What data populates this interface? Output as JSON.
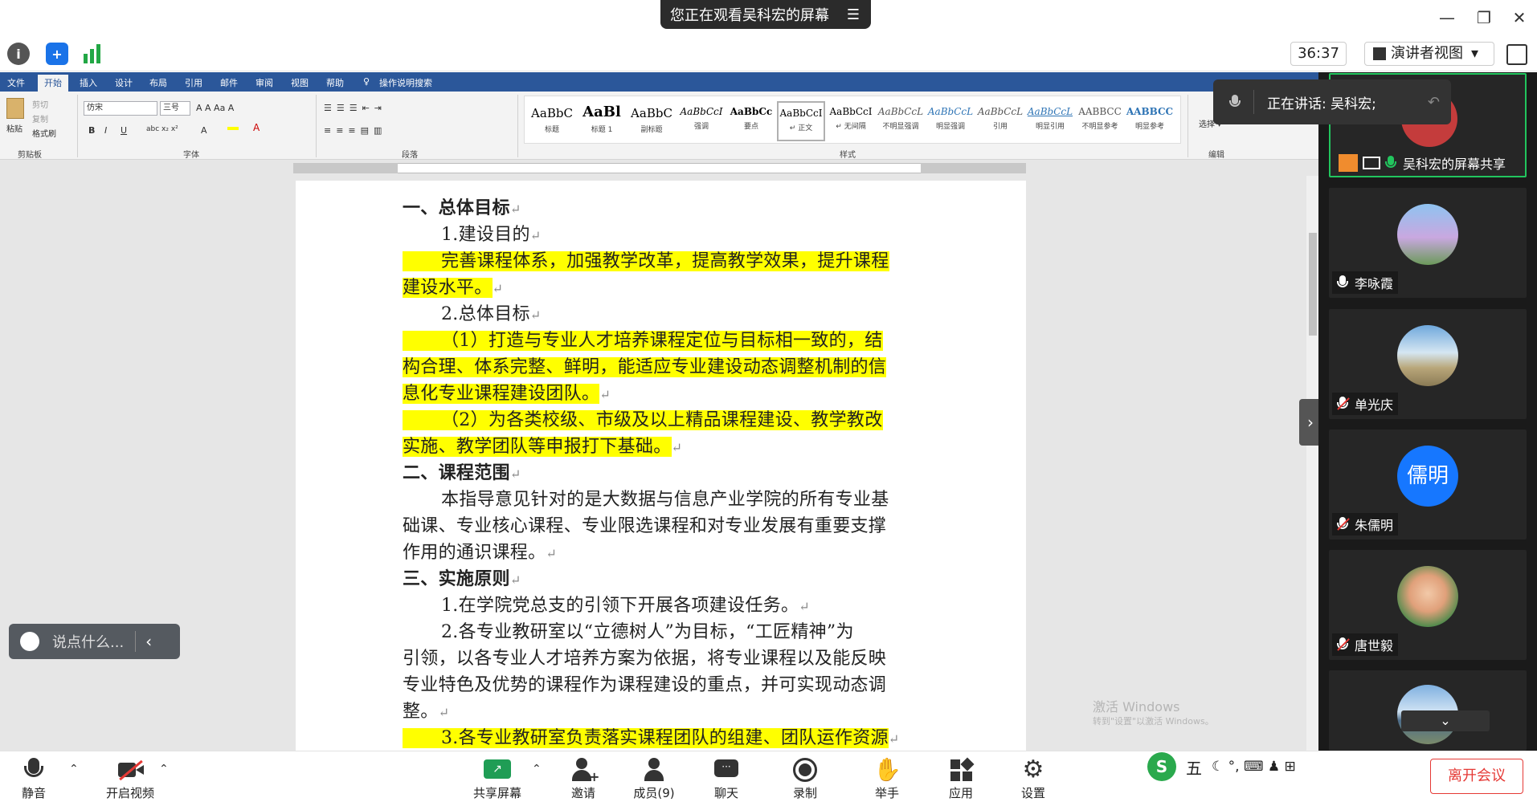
{
  "banner": {
    "text": "您正在观看吴科宏的屏幕",
    "menu_icon": "menu-icon"
  },
  "window": {
    "min": "—",
    "restore": "❐",
    "close": "✕"
  },
  "zoom_top": {
    "timer": "36:37",
    "view_label": "演讲者视图",
    "view_caret": "▾"
  },
  "word": {
    "tabs": [
      "文件",
      "开始",
      "插入",
      "设计",
      "布局",
      "引用",
      "邮件",
      "审阅",
      "视图",
      "帮助",
      "操作说明搜索"
    ],
    "clipboard": {
      "paste": "粘贴",
      "cut": "剪切",
      "copy": "复制",
      "format_painter": "格式刷",
      "group": "剪贴板"
    },
    "font": {
      "name": "仿宋",
      "size": "三号",
      "group": "字体"
    },
    "paragraph_group": "段落",
    "styles_group": "样式",
    "styles": [
      {
        "preview": "AaBbC",
        "name": "标题"
      },
      {
        "preview": "AaBl",
        "name": "标题 1"
      },
      {
        "preview": "AaBbC",
        "name": "副标题"
      },
      {
        "preview": "AaBbCcI",
        "name": "强调"
      },
      {
        "preview": "AaBbCc",
        "name": "要点"
      },
      {
        "preview": "AaBbCcI",
        "name": "↵ 正文"
      },
      {
        "preview": "AaBbCcI",
        "name": "↵ 无间隔"
      },
      {
        "preview": "AaBbCcL",
        "name": "不明显强调"
      },
      {
        "preview": "AaBbCcL",
        "name": "明显强调"
      },
      {
        "preview": "AaBbCcL",
        "name": "引用"
      },
      {
        "preview": "AaBbCcL",
        "name": "明显引用"
      },
      {
        "preview": "AABBCC",
        "name": "不明显参考"
      },
      {
        "preview": "AABBCC",
        "name": "明显参考"
      }
    ],
    "editing": {
      "select": "选择 ▾",
      "group": "编辑"
    }
  },
  "document": {
    "lines": [
      {
        "text": "一、总体目标",
        "style": "heading"
      },
      {
        "text": "1.建设目的",
        "style": "indent"
      },
      {
        "text": "完善课程体系，加强教学改革，提高教学效果，提升课程",
        "style": "indent-hl"
      },
      {
        "text": "建设水平。",
        "style": "hl"
      },
      {
        "text": "2.总体目标",
        "style": "indent"
      },
      {
        "text": "（1）打造与专业人才培养课程定位与目标相一致的，结",
        "style": "indent-hl"
      },
      {
        "text": "构合理、体系完整、鲜明，能适应专业建设动态调整机制的信",
        "style": "hl"
      },
      {
        "text": "息化专业课程建设团队。",
        "style": "hl"
      },
      {
        "text": "（2）为各类校级、市级及以上精品课程建设、教学教改",
        "style": "indent-hl"
      },
      {
        "text": "实施、教学团队等申报打下基础。",
        "style": "hl"
      },
      {
        "text": "二、课程范围",
        "style": "heading"
      },
      {
        "text": "本指导意见针对的是大数据与信息产业学院的所有专业基",
        "style": "indent"
      },
      {
        "text": "础课、专业核心课程、专业限选课程和对专业发展有重要支撑",
        "style": "plain"
      },
      {
        "text": "作用的通识课程。",
        "style": "plain"
      },
      {
        "text": "三、实施原则",
        "style": "heading"
      },
      {
        "text": "1.在学院党总支的引领下开展各项建设任务。",
        "style": "indent"
      },
      {
        "text": "2.各专业教研室以“立德树人”为目标，“工匠精神”为",
        "style": "indent"
      },
      {
        "text": "引领，以各专业人才培养方案为依据，将专业课程以及能反映",
        "style": "plain"
      },
      {
        "text": "专业特色及优势的课程作为课程建设的重点，并可实现动态调",
        "style": "plain"
      },
      {
        "text": "整。",
        "style": "plain"
      },
      {
        "text": "3.各专业教研室负责落实课程团队的组建、团队运作资源",
        "style": "indent-hl"
      }
    ],
    "para_mark": "↵"
  },
  "chat_box": {
    "placeholder": "说点什么...",
    "collapse": "‹"
  },
  "panel_toggle": "›",
  "watermark": {
    "line1": "激活 Windows",
    "line2": "转到\"设置\"以激活 Windows。"
  },
  "speaking": {
    "label": "正在讲话: 吴科宏;"
  },
  "participants": [
    {
      "name": "吴科宏的屏幕共享",
      "muted": false,
      "active": true
    },
    {
      "name": "李咏霞",
      "muted": false,
      "active": false
    },
    {
      "name": "单光庆",
      "muted": true,
      "active": false
    },
    {
      "name": "朱儒明",
      "muted": true,
      "active": false,
      "initials": "儒明"
    },
    {
      "name": "唐世毅",
      "muted": true,
      "active": false
    },
    {
      "name": "",
      "muted": false,
      "active": false
    }
  ],
  "toolbar": {
    "mute": "静音",
    "video": "开启视频",
    "share": "共享屏幕",
    "invite": "邀请",
    "members": "成员(9)",
    "chat": "聊天",
    "record": "录制",
    "raise_hand": "举手",
    "apps": "应用",
    "settings": "设置",
    "leave": "离开会议"
  },
  "ime": {
    "logo": "S",
    "mode": "五",
    "icons": "☾ °, ⌨ ♟ ⊞"
  },
  "colors": {
    "ribbon_blue": "#2b579a",
    "highlight": "#ffff00",
    "leave_red": "#e53935",
    "active_green": "#22c55e"
  }
}
